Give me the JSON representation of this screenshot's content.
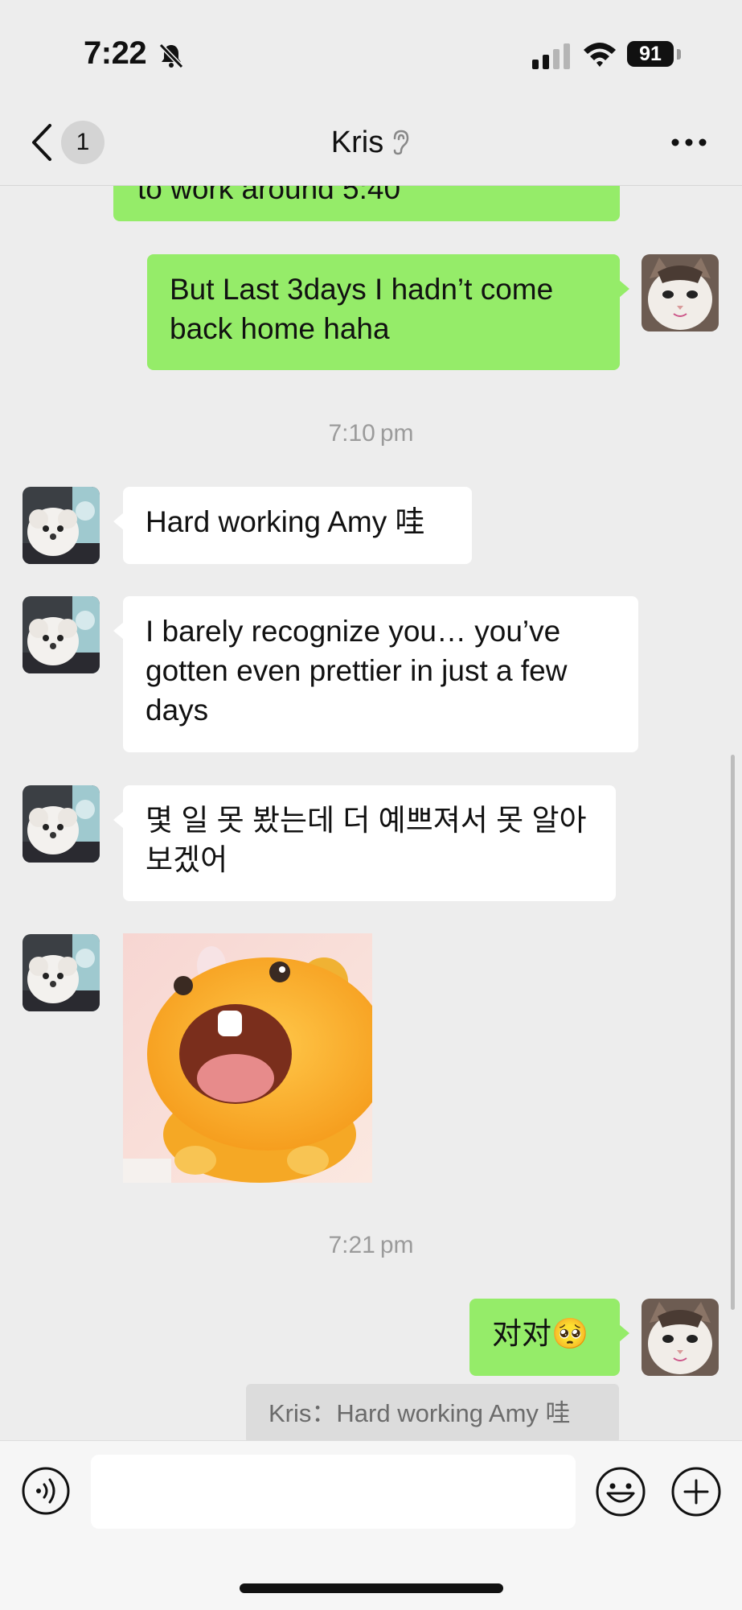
{
  "status_bar": {
    "time": "7:22",
    "battery": "91"
  },
  "header": {
    "back_badge": "1",
    "contact_name": "Kris"
  },
  "messages": {
    "m0_partial": "to work around 5:40",
    "m1": "But Last 3days I hadn’t come back home haha",
    "ts1": "7:10 pm",
    "m2": "Hard working Amy 哇",
    "m3": "I barely recognize you… you’ve gotten even prettier in just a few days",
    "m4": "몇 일 못 봤는데 더 예쁘져서 못 알아보겠어",
    "ts2": "7:21 pm",
    "m5": "对对🥺",
    "quote": "Kris：Hard working Amy 哇"
  },
  "icons": {
    "back": "chevron-left-icon",
    "more": "more-horizontal-icon",
    "voice": "voice-input-icon",
    "emoji": "emoji-icon",
    "plus": "plus-icon"
  },
  "colors": {
    "sent_bubble": "#95ec69",
    "received_bubble": "#ffffff",
    "background": "#ededed"
  }
}
